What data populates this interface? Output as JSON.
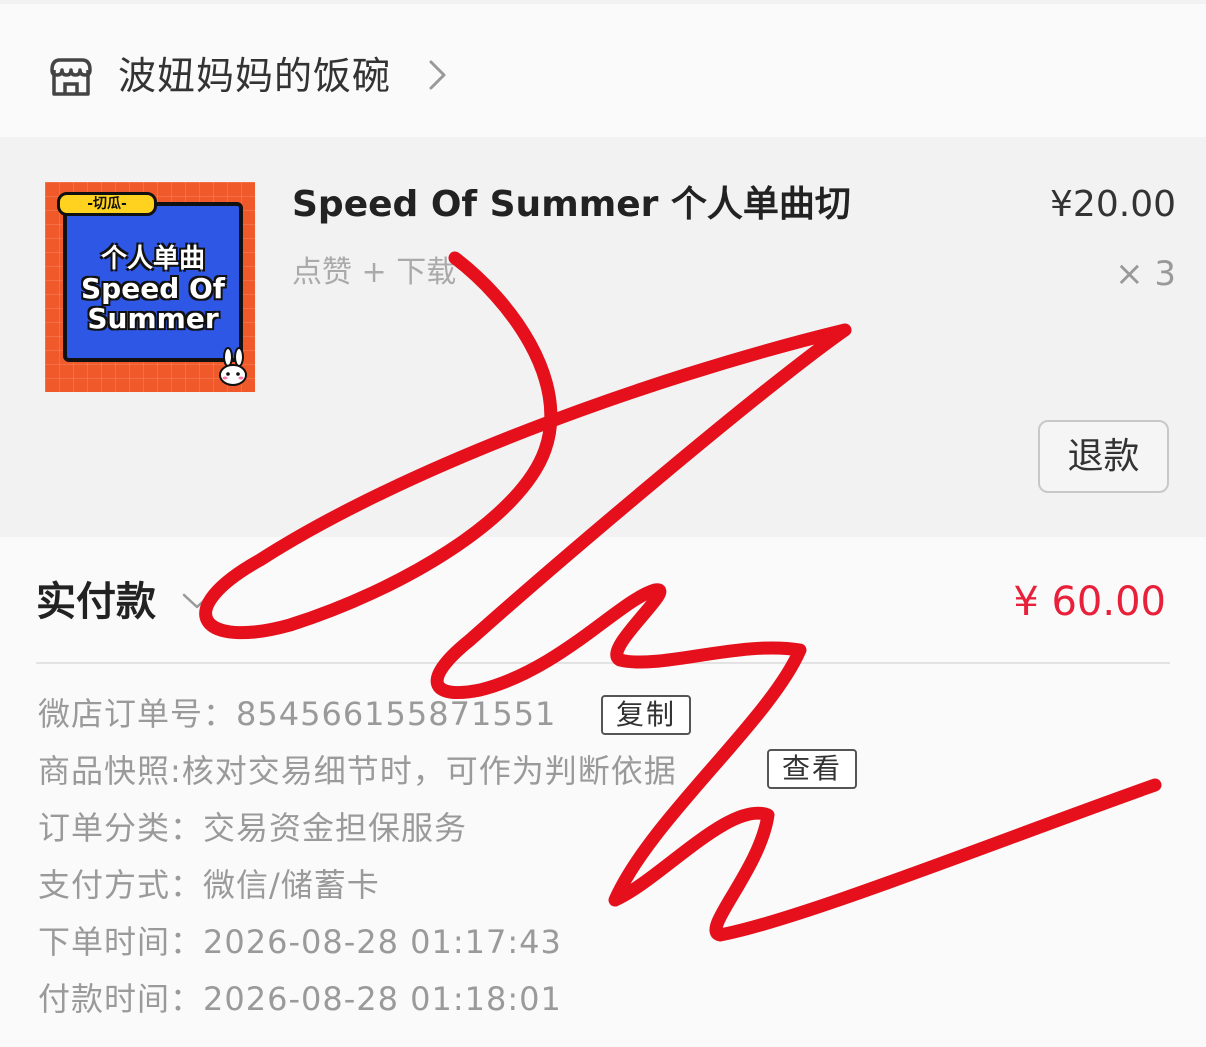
{
  "shop": {
    "name": "波妞妈妈的饭碗"
  },
  "product": {
    "title": "Speed Of Summer 个人单曲切",
    "spec": "点赞 + 下载",
    "price": "¥20.00",
    "quantity": "× 3",
    "refund_label": "退款",
    "thumbnail": {
      "tag": "-切瓜-",
      "line1": "个人单曲",
      "line2": "Speed Of",
      "line3": "Summer"
    }
  },
  "payment": {
    "label": "实付款",
    "amount": "¥ 60.00"
  },
  "details": {
    "order_no_label": "微店订单号：",
    "order_no": "854566155871551",
    "copy_label": "复制",
    "snapshot_label": "商品快照:",
    "snapshot_value": "核对交易细节时，可作为判断依据",
    "view_label": "查看",
    "category_label": "订单分类：",
    "category_value": "交易资金担保服务",
    "method_label": "支付方式：",
    "method_value": "微信/储蓄卡",
    "order_time_label": "下单时间：",
    "order_time": "2026-08-28 01:17:43",
    "pay_time_label": "付款时间：",
    "pay_time": "2026-08-28 01:18:01"
  },
  "colors": {
    "price_red": "#e8203a",
    "scribble_red": "#e5101c",
    "thumb_orange": "#f05a2a",
    "thumb_blue": "#2f57e6"
  }
}
